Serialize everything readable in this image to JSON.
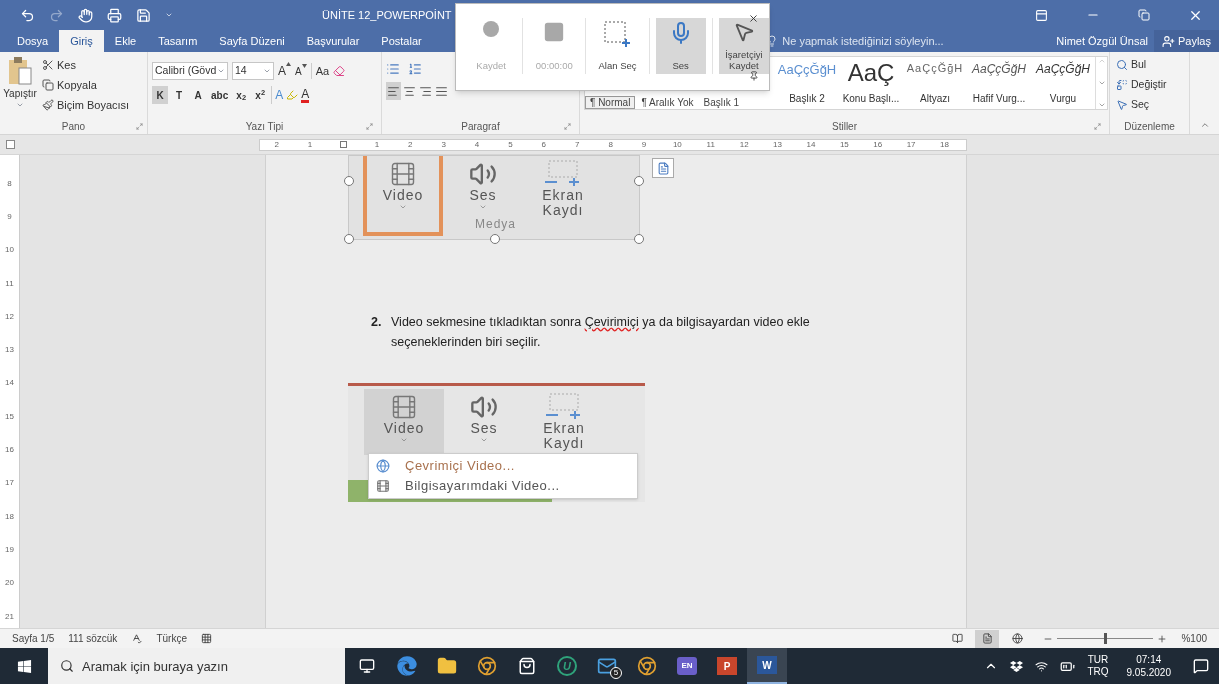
{
  "title_bar": {
    "title": "ÜNİTE 12_POWERPOİNT"
  },
  "tabs": [
    {
      "label": "Dosya",
      "selected": false
    },
    {
      "label": "Giriş",
      "selected": true
    },
    {
      "label": "Ekle",
      "selected": false
    },
    {
      "label": "Tasarım",
      "selected": false
    },
    {
      "label": "Sayfa Düzeni",
      "selected": false
    },
    {
      "label": "Başvurular",
      "selected": false
    },
    {
      "label": "Postalar",
      "selected": false
    }
  ],
  "tell_me": {
    "placeholder": "Ne yapmak istediğinizi söyleyin..."
  },
  "user": "Nimet Özgül Ünsal",
  "share": "Paylaş",
  "ribbon": {
    "clipboard": {
      "paste": "Yapıştır",
      "items": [
        "Kes",
        "Kopyala",
        "Biçim Boyacısı"
      ],
      "label": "Pano"
    },
    "font": {
      "font_name": "Calibri (Gövd",
      "font_size": "14",
      "grow": "A",
      "shrink": "A",
      "case": "Aa",
      "format_buttons": [
        {
          "label": "K",
          "selected": true
        },
        {
          "label": "T",
          "selected": false
        },
        {
          "label": "A",
          "selected": false
        },
        {
          "label": "abc",
          "selected": false
        },
        {
          "label": "x$_{2}$",
          "selected": false
        },
        {
          "label": "x$^{2}$",
          "selected": false
        }
      ],
      "text_effect": "A",
      "font_color": "A",
      "label": "Yazı Tipi"
    },
    "paragraph": {
      "align": [
        {
          "selected": true
        },
        {
          "selected": false
        },
        {
          "selected": false
        },
        {
          "selected": false
        }
      ],
      "label": "Paragraf"
    },
    "styles": {
      "items": [
        {
          "kind": "normal",
          "sample": "¶ Normal",
          "selected": true
        },
        {
          "kind": "no-spacing",
          "sample": "¶ Aralık Yok",
          "selected": false
        },
        {
          "kind": "heading1",
          "sample": "Başlık 1",
          "selected": false
        },
        {
          "kind": "heading2",
          "sample": "AaÇçĞğH",
          "label": "Başlık 2",
          "selected": false
        },
        {
          "kind": "title",
          "sample": "AaÇ",
          "label": "Konu Başlı...",
          "selected": false
        },
        {
          "kind": "subtitle",
          "sample": "AaÇçĞğH",
          "label": "Altyazı",
          "selected": false
        },
        {
          "kind": "subtle-emphasis",
          "sample": "AaÇçĞğH",
          "label": "Hafif Vurg...",
          "selected": false
        },
        {
          "kind": "emphasis",
          "sample": "AaÇçĞğH",
          "label": "Vurgu",
          "selected": false
        }
      ],
      "label": "Stiller"
    },
    "editing": {
      "items": [
        {
          "kind": "find",
          "label": "Bul"
        },
        {
          "kind": "replace",
          "label": "Değiştir"
        },
        {
          "kind": "select",
          "label": "Seç"
        }
      ],
      "label": "Düzenleme"
    }
  },
  "recorder": {
    "buttons": [
      {
        "kind": "record",
        "label": "Kaydet",
        "disabled": true,
        "selected": false
      },
      {
        "kind": "stop",
        "label": "00:00:00",
        "disabled": true,
        "selected": false
      },
      {
        "kind": "area",
        "label": "Alan Seç",
        "disabled": false,
        "selected": false
      },
      {
        "kind": "audio",
        "label": "Ses",
        "disabled": false,
        "selected": true
      },
      {
        "kind": "pointer",
        "label": "İşaretçiyi Kaydet",
        "disabled": false,
        "selected": true
      }
    ]
  },
  "ruler": {
    "horizontal": [
      "2",
      "1",
      "1",
      "2",
      "3",
      "4",
      "5",
      "6",
      "7",
      "8",
      "9",
      "10",
      "11",
      "12",
      "13",
      "14",
      "15",
      "16",
      "17",
      "18"
    ],
    "vertical": [
      "8",
      "9",
      "10",
      "11",
      "12",
      "13",
      "14",
      "15",
      "16",
      "17",
      "18",
      "19",
      "20",
      "21"
    ]
  },
  "document": {
    "figure1": {
      "buttons": [
        {
          "kind": "video",
          "label": "Video",
          "selected": true
        },
        {
          "kind": "audio",
          "label": "Ses",
          "selected": false
        },
        {
          "kind": "screen",
          "label": "Ekran Kaydı",
          "selected": false
        }
      ],
      "group_label": "Medya"
    },
    "step": {
      "number": "2.",
      "parts": [
        {
          "text": "Video sekmesine tıkladıktan sonra ",
          "misspelled": false
        },
        {
          "text": "Çevirimiçi",
          "misspelled": true
        },
        {
          "text": " ya da bilgisayardan video ekle seçeneklerinden biri seçilir.",
          "misspelled": false
        }
      ]
    },
    "figure2": {
      "buttons": [
        {
          "kind": "video",
          "label": "Video",
          "selected": true
        },
        {
          "kind": "audio",
          "label": "Ses",
          "selected": false
        },
        {
          "kind": "screen",
          "label": "Ekran Kaydı",
          "selected": false
        }
      ],
      "menu": [
        {
          "kind": "online",
          "label": "Çevrimiçi Video...",
          "selected": true
        },
        {
          "kind": "local",
          "label": "Bilgisayarımdaki Video...",
          "selected": false
        }
      ]
    }
  },
  "status_bar": {
    "page": "Sayfa 1/5",
    "words": "111 sözcük",
    "language": "Türkçe",
    "views": [
      {
        "selected": false
      },
      {
        "selected": true
      },
      {
        "selected": false
      }
    ],
    "zoom": {
      "level": 0.5,
      "label": "%100"
    }
  },
  "taskbar": {
    "search_placeholder": "Aramak için buraya yazın",
    "apps": [
      {
        "kind": "task-view",
        "selected": false
      },
      {
        "kind": "edge",
        "selected": false
      },
      {
        "kind": "explorer",
        "selected": false
      },
      {
        "kind": "chrome",
        "selected": false
      },
      {
        "kind": "store",
        "selected": false
      },
      {
        "kind": "letter-circle",
        "label": "U",
        "selected": false
      },
      {
        "kind": "mail",
        "badge": "5",
        "selected": false
      },
      {
        "kind": "chrome",
        "selected": false
      },
      {
        "kind": "letter-square",
        "label": "EN",
        "selected": false
      },
      {
        "kind": "powerpoint",
        "label": "P",
        "selected": false
      },
      {
        "kind": "word",
        "label": "W",
        "selected": true
      }
    ],
    "tray": {
      "lang": "TUR",
      "layout": "TRQ",
      "time": "07:14",
      "date": "9.05.2020"
    }
  }
}
